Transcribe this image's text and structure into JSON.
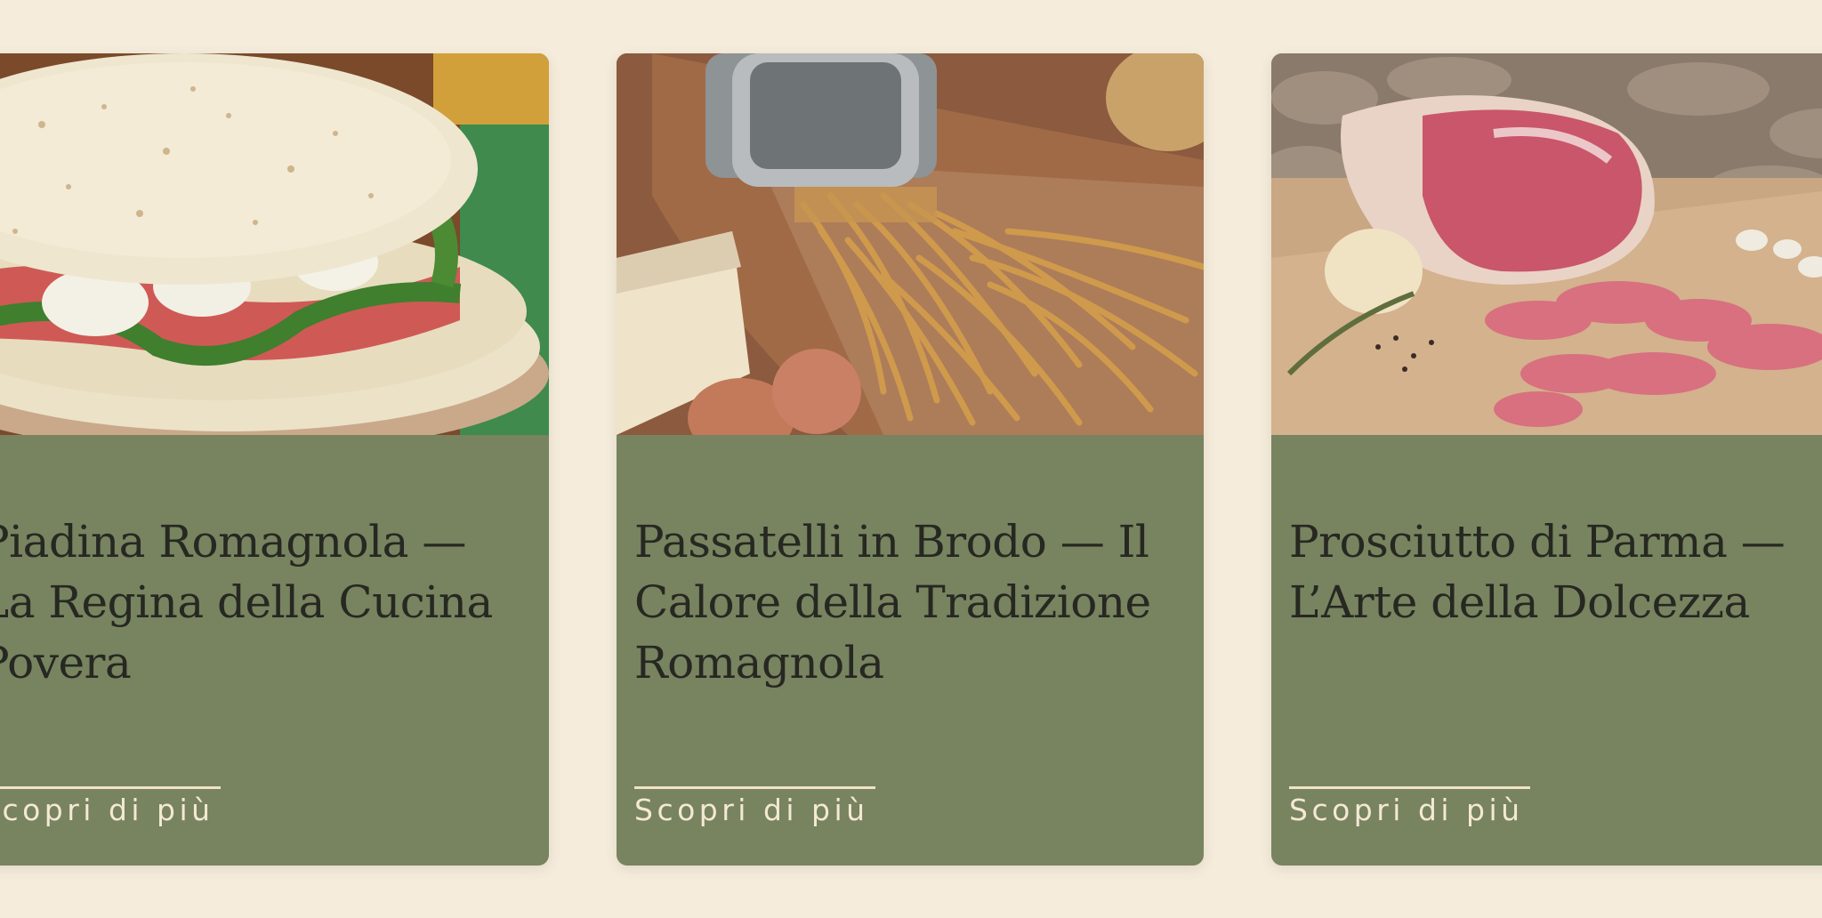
{
  "cards": [
    {
      "title": "Piadina Romagnola — La Regina della Cucina Povera",
      "link_label": "Scopri di più",
      "image_icon": "piadina-photo-icon"
    },
    {
      "title": "Passatelli in Brodo — Il Calore della Tradizione Romagnola",
      "link_label": "Scopri di più",
      "image_icon": "passatelli-photo-icon"
    },
    {
      "title": "Prosciutto di Parma — L’Arte della Dolcezza",
      "link_label": "Scopri di più",
      "image_icon": "prosciutto-photo-icon"
    }
  ],
  "colors": {
    "page_background": "#f5ecdc",
    "card_background": "#788360",
    "title_text": "#262821",
    "link_text": "#f3e9d4"
  }
}
